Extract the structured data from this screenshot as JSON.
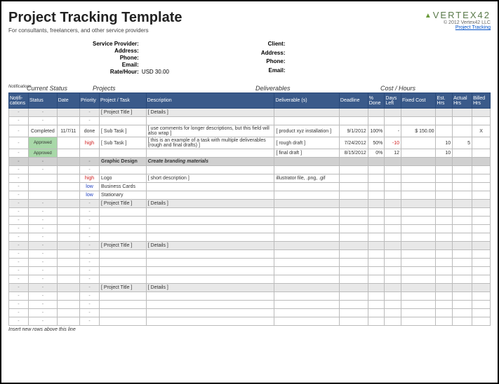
{
  "header": {
    "title": "Project Tracking Template",
    "subtitle": "For consultants, freelancers, and other service providers",
    "brand_name": "VERTEX42",
    "copyright": "© 2012 Vertex42 LLC",
    "link": "Project Tracking"
  },
  "provider": {
    "l1": "Service Provider:",
    "v1": "",
    "l2": "Address:",
    "v2": "",
    "l3": "Phone:",
    "v3": "",
    "l4": "Email:",
    "v4": "",
    "l5": "Rate/Hour:",
    "v5": "USD 30.00"
  },
  "client": {
    "l1": "Client:",
    "v1": "",
    "l2": "Address:",
    "v2": "",
    "l3": "Phone:",
    "v3": "",
    "l4": "Email:",
    "v4": ""
  },
  "sec": {
    "notif": "Notifications",
    "status": "Current Status",
    "proj": "Projects",
    "deliv": "Deliverables",
    "cost": "Cost / Hours"
  },
  "cols": {
    "notif": "Notifi-cations",
    "status": "Status",
    "date": "Date",
    "prio": "Priority",
    "task": "Project / Task",
    "desc": "Description",
    "deliv": "Deliverable (s)",
    "dead": "Deadline",
    "done": "% Done",
    "days": "Days Left",
    "fixed": "Fixed Cost",
    "est": "Est. Hrs",
    "act": "Actual Hrs",
    "bill": "Billed Hrs"
  },
  "rows": [
    {
      "type": "gray_title",
      "task": "[ Project Title ]",
      "desc": "[ Details ]"
    },
    {
      "type": "blank"
    },
    {
      "type": "data",
      "status": "Completed",
      "date": "11/7/11",
      "prio": "done",
      "task": "[ Sub Task ]",
      "desc": "[ use comments for longer descriptions, but this field will also wrap ]",
      "deliv": "[ product xyz installation ]",
      "dead": "9/1/2012",
      "done": "100%",
      "days": "-",
      "fixed": "$      150.00",
      "bill": "X"
    },
    {
      "type": "data",
      "status_class": "approved",
      "status": "Approved",
      "prio": "high",
      "prio_class": "hi",
      "task": "[ Sub Task ]",
      "desc": "[ this is an example of a task with multiple deliverables (rough and final drafts) ]",
      "deliv": "[ rough draft ]",
      "dead": "7/24/2012",
      "done": "50%",
      "days": "-10",
      "days_class": "neg",
      "est": "10",
      "act": "5"
    },
    {
      "type": "data",
      "status_class": "approved",
      "status": "Approved",
      "deliv": "[ final draft ]",
      "dead": "8/15/2012",
      "done": "0%",
      "days": "12",
      "est": "10"
    },
    {
      "type": "grp",
      "task": "Graphic Design",
      "desc": "Create branding materials"
    },
    {
      "type": "blank"
    },
    {
      "type": "data",
      "prio": "high",
      "prio_class": "hi",
      "task": "Logo",
      "desc": "[ short description ]",
      "deliv": "illustrator file, .png, .gif"
    },
    {
      "type": "data",
      "prio": "low",
      "prio_class": "lo",
      "task": "Business Cards"
    },
    {
      "type": "data",
      "prio": "low",
      "prio_class": "lo",
      "task": "Stationary"
    },
    {
      "type": "gray_title",
      "task": "[ Project Title ]",
      "desc": "[ Details ]"
    },
    {
      "type": "blank"
    },
    {
      "type": "blank"
    },
    {
      "type": "blank"
    },
    {
      "type": "blank"
    },
    {
      "type": "gray_title",
      "task": "[ Project Title ]",
      "desc": "[ Details ]"
    },
    {
      "type": "blank"
    },
    {
      "type": "blank"
    },
    {
      "type": "blank"
    },
    {
      "type": "blank"
    },
    {
      "type": "gray_title",
      "task": "[ Project Title ]",
      "desc": "[ Details ]"
    },
    {
      "type": "blank"
    },
    {
      "type": "blank"
    },
    {
      "type": "blank"
    },
    {
      "type": "blank"
    }
  ],
  "footer": "Insert new rows above this line"
}
